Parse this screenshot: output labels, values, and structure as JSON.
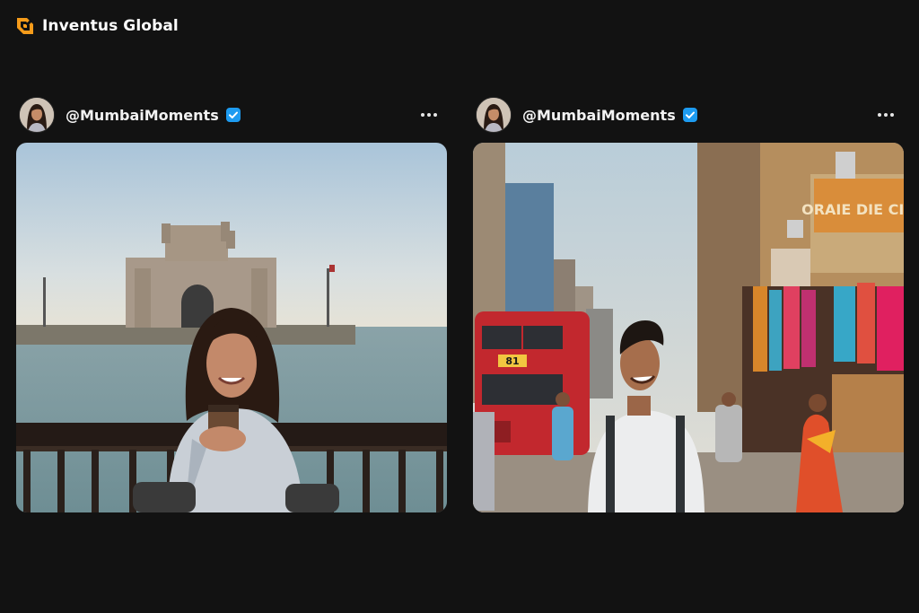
{
  "brand": {
    "name": "Inventus Global",
    "logo_icon": "inventus-logo-icon",
    "accent_color": "#f59b1a"
  },
  "posts": [
    {
      "username": "@MumbaiMoments",
      "verified": true,
      "verified_color": "#1d9bf0",
      "menu_icon": "more-options-icon",
      "photo": "woman-with-coffee-at-gateway-of-india"
    },
    {
      "username": "@MumbaiMoments",
      "verified": true,
      "verified_color": "#1d9bf0",
      "menu_icon": "more-options-icon",
      "photo": "man-walking-mumbai-street-market",
      "bus_sign": "81",
      "shop_sign": "ORAIE DIE CIO"
    }
  ]
}
